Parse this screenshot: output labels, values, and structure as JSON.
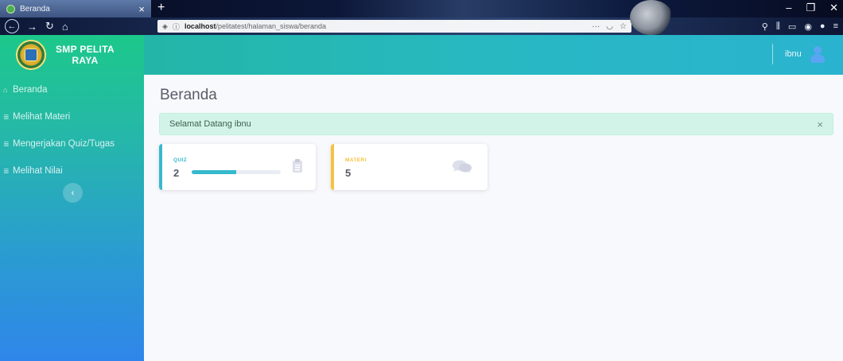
{
  "browser": {
    "tab_title": "Beranda",
    "tab_close": "×",
    "new_tab": "+",
    "url_host": "localhost",
    "url_path": "/pelitatest/halaman_siswa/beranda",
    "window_controls": [
      "–",
      "❐",
      "✕"
    ]
  },
  "sidebar": {
    "brand_line1": "SMP PELITA",
    "brand_line2": "RAYA",
    "items": [
      {
        "label": "Beranda",
        "icon": "home-icon"
      },
      {
        "label": "Melihat Materi",
        "icon": "list-icon"
      },
      {
        "label": "Mengerjakan Quiz/Tugas",
        "icon": "list-icon"
      },
      {
        "label": "Melihat Nilai",
        "icon": "list-icon"
      }
    ],
    "toggle_icon": "‹"
  },
  "topbar": {
    "user_name": "ibnu"
  },
  "main": {
    "page_title": "Beranda",
    "alert_text": "Selamat Datang ibnu",
    "alert_close": "×",
    "cards": [
      {
        "label": "QUIZ",
        "value": "2",
        "progress": 0.5,
        "icon": "clipboard-icon"
      },
      {
        "label": "MATERI",
        "value": "5",
        "icon": "comments-icon"
      }
    ]
  },
  "colors": {
    "sidebar_top": "#1cc88a",
    "sidebar_bottom": "#2f86ea",
    "quiz_accent": "#36b9cc",
    "materi_accent": "#f6c23e",
    "alert_bg": "#d2f4e8"
  }
}
